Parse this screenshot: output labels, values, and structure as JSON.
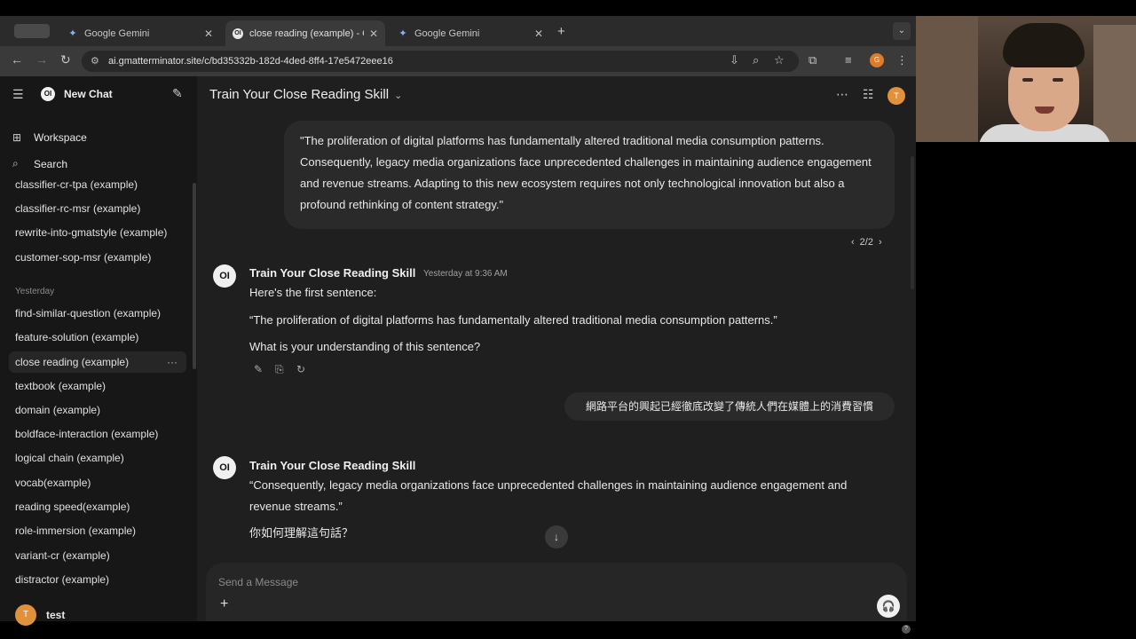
{
  "browser": {
    "tab_group_label": "",
    "tabs": [
      {
        "label": "Google Gemini",
        "active": false
      },
      {
        "label": "close reading (example) - GM",
        "active": true
      },
      {
        "label": "Google Gemini",
        "active": false
      }
    ],
    "url": "ai.gmatterminator.site/c/bd35332b-182d-4ded-8ff4-17e5472eee16",
    "profile_initial": "G"
  },
  "sidebar": {
    "new_chat": "New Chat",
    "workspace": "Workspace",
    "search": "Search",
    "recent_items": [
      "classifier-cr-tpa (example)",
      "classifier-rc-msr (example)",
      "rewrite-into-gmatstyle (example)",
      "customer-sop-msr (example)"
    ],
    "yesterday_label": "Yesterday",
    "yesterday_items": [
      "find-similar-question (example)",
      "feature-solution (example)",
      "close reading (example)",
      "textbook (example)",
      "domain (example)",
      "boldface-interaction (example)",
      "logical chain (example)",
      "vocab(example)",
      "reading speed(example)",
      "role-immersion (example)",
      "variant-cr (example)",
      "distractor (example)"
    ],
    "more_label": "···",
    "user": {
      "initial": "T",
      "name": "test"
    }
  },
  "main": {
    "model_title": "Train Your Close Reading Skill",
    "user_avatar_initial": "T",
    "user_message": "\"The proliferation of digital platforms has fundamentally altered traditional media consumption patterns. Consequently, legacy media organizations face unprecedented challenges in maintaining audience engagement and revenue streams. Adapting to this new ecosystem requires not only technological innovation but also a profound rethinking of content strategy.\"",
    "pager": "2/2",
    "bot_avatar": "OI",
    "message1": {
      "name": "Train Your Close Reading Skill",
      "time": "Yesterday at 9:36 AM",
      "line1": "Here's the first sentence:",
      "line2": "“The proliferation of digital platforms has fundamentally altered traditional media consumption patterns.”",
      "line3": "What is your understanding of this sentence?"
    },
    "user_reply": "網路平台的興起已經徹底改變了傳統人們在媒體上的消費習慣",
    "message2": {
      "name": "Train Your Close Reading Skill",
      "line1": "“Consequently, legacy media organizations face unprecedented challenges in maintaining audience engagement and",
      "line2": "revenue streams.”",
      "line3": "你如何理解這句話？"
    },
    "composer_placeholder": "Send a Message",
    "help_label": "?"
  }
}
